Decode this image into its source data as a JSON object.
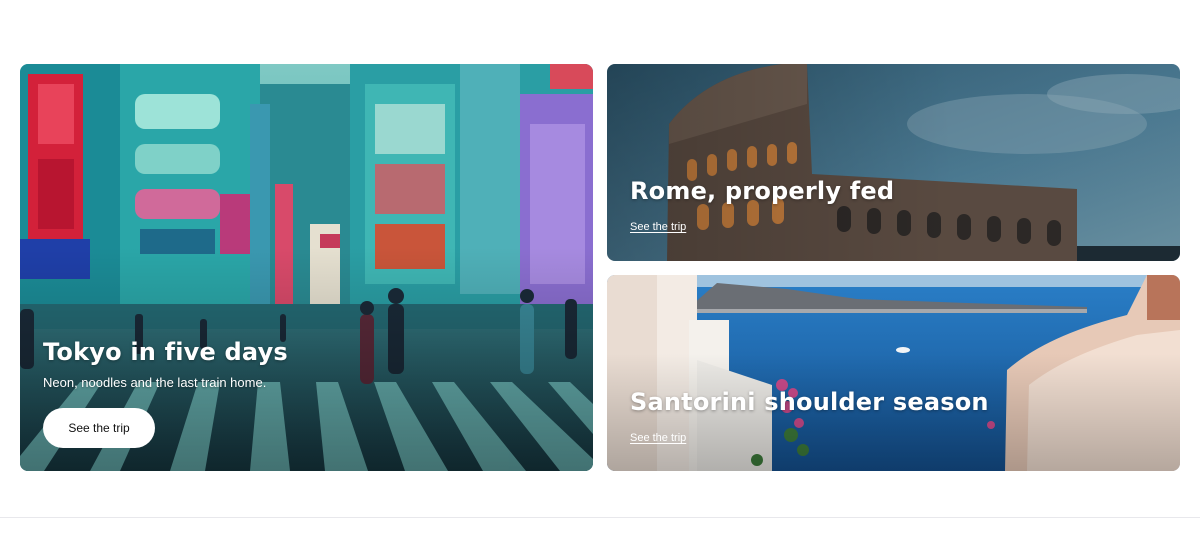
{
  "cards": [
    {
      "id": "tokyo",
      "title": "Tokyo in five days",
      "subtitle": "Neon, noodles and the last train home.",
      "cta": "See the trip"
    },
    {
      "id": "rome",
      "title": "Rome, properly fed",
      "cta": "See the trip"
    },
    {
      "id": "santorini",
      "title": "Santorini shoulder season",
      "cta": "See the trip"
    }
  ],
  "colors": {
    "tokyo_accent": "#1fa5a8",
    "rome_sky": "#3f6f8a",
    "santorini_sea": "#1c65b6",
    "button_bg": "#ffffff"
  }
}
